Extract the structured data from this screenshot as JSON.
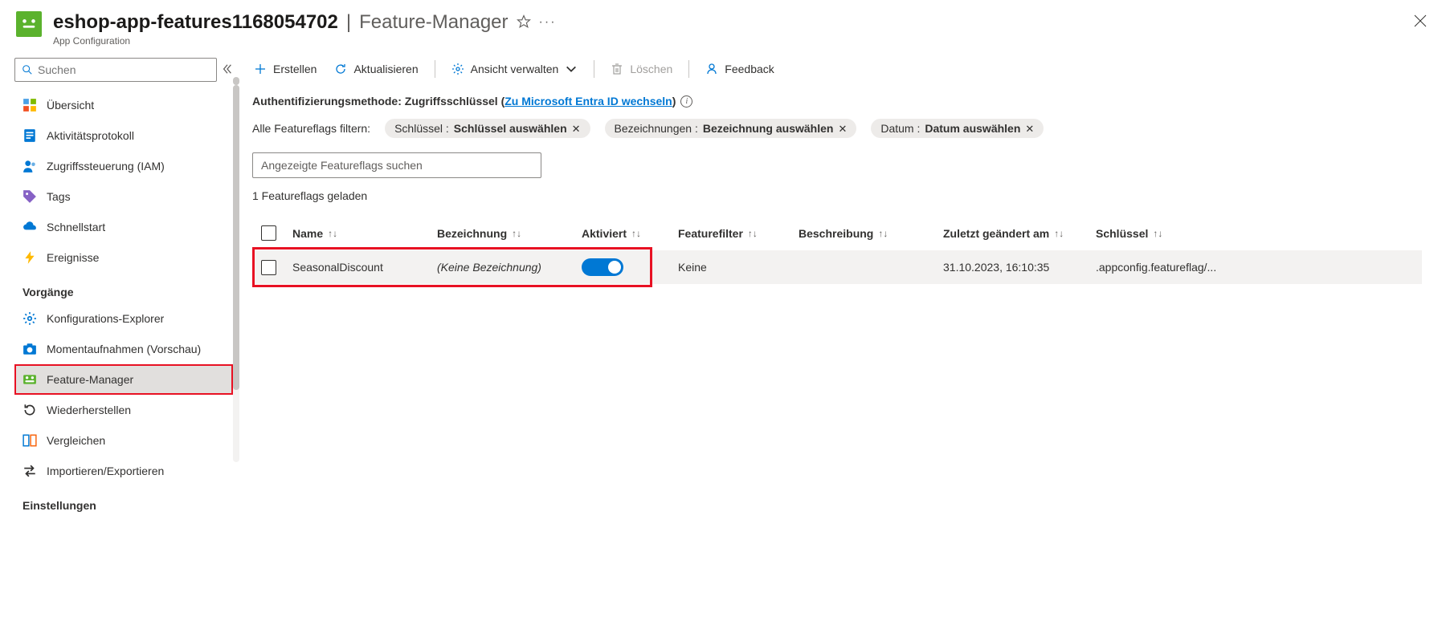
{
  "header": {
    "resource_name": "eshop-app-features1168054702",
    "page_title": "Feature-Manager",
    "service": "App Configuration"
  },
  "sidebar": {
    "search_placeholder": "Suchen",
    "items_top": [
      {
        "label": "Übersicht"
      },
      {
        "label": "Aktivitätsprotokoll"
      },
      {
        "label": "Zugriffssteuerung (IAM)"
      },
      {
        "label": "Tags"
      },
      {
        "label": "Schnellstart"
      },
      {
        "label": "Ereignisse"
      }
    ],
    "group_ops": "Vorgänge",
    "items_ops": [
      {
        "label": "Konfigurations-Explorer"
      },
      {
        "label": "Momentaufnahmen (Vorschau)"
      },
      {
        "label": "Feature-Manager"
      },
      {
        "label": "Wiederherstellen"
      },
      {
        "label": "Vergleichen"
      },
      {
        "label": "Importieren/Exportieren"
      }
    ],
    "group_settings": "Einstellungen"
  },
  "toolbar": {
    "create": "Erstellen",
    "refresh": "Aktualisieren",
    "manage_view": "Ansicht verwalten",
    "delete": "Löschen",
    "feedback": "Feedback"
  },
  "auth": {
    "prefix": "Authentifizierungsmethode: Zugriffsschlüssel (",
    "link": "Zu Microsoft Entra ID wechseln",
    "suffix": ")"
  },
  "filters": {
    "label": "Alle Featureflags filtern:",
    "key_prefix": "Schlüssel : ",
    "key_value": "Schlüssel auswählen",
    "bez_prefix": "Bezeichnungen : ",
    "bez_value": "Bezeichnung auswählen",
    "date_prefix": "Datum : ",
    "date_value": "Datum auswählen"
  },
  "ff_search_placeholder": "Angezeigte Featureflags suchen",
  "loaded_text": "1 Featureflags geladen",
  "columns": {
    "name": "Name",
    "bez": "Bezeichnung",
    "akt": "Aktiviert",
    "ff": "Featurefilter",
    "besch": "Beschreibung",
    "date": "Zuletzt geändert am",
    "key": "Schlüssel"
  },
  "rows": [
    {
      "name": "SeasonalDiscount",
      "bez": "(Keine Bezeichnung)",
      "ff": "Keine",
      "besch": "",
      "date": "31.10.2023, 16:10:35",
      "key": ".appconfig.featureflag/..."
    }
  ]
}
